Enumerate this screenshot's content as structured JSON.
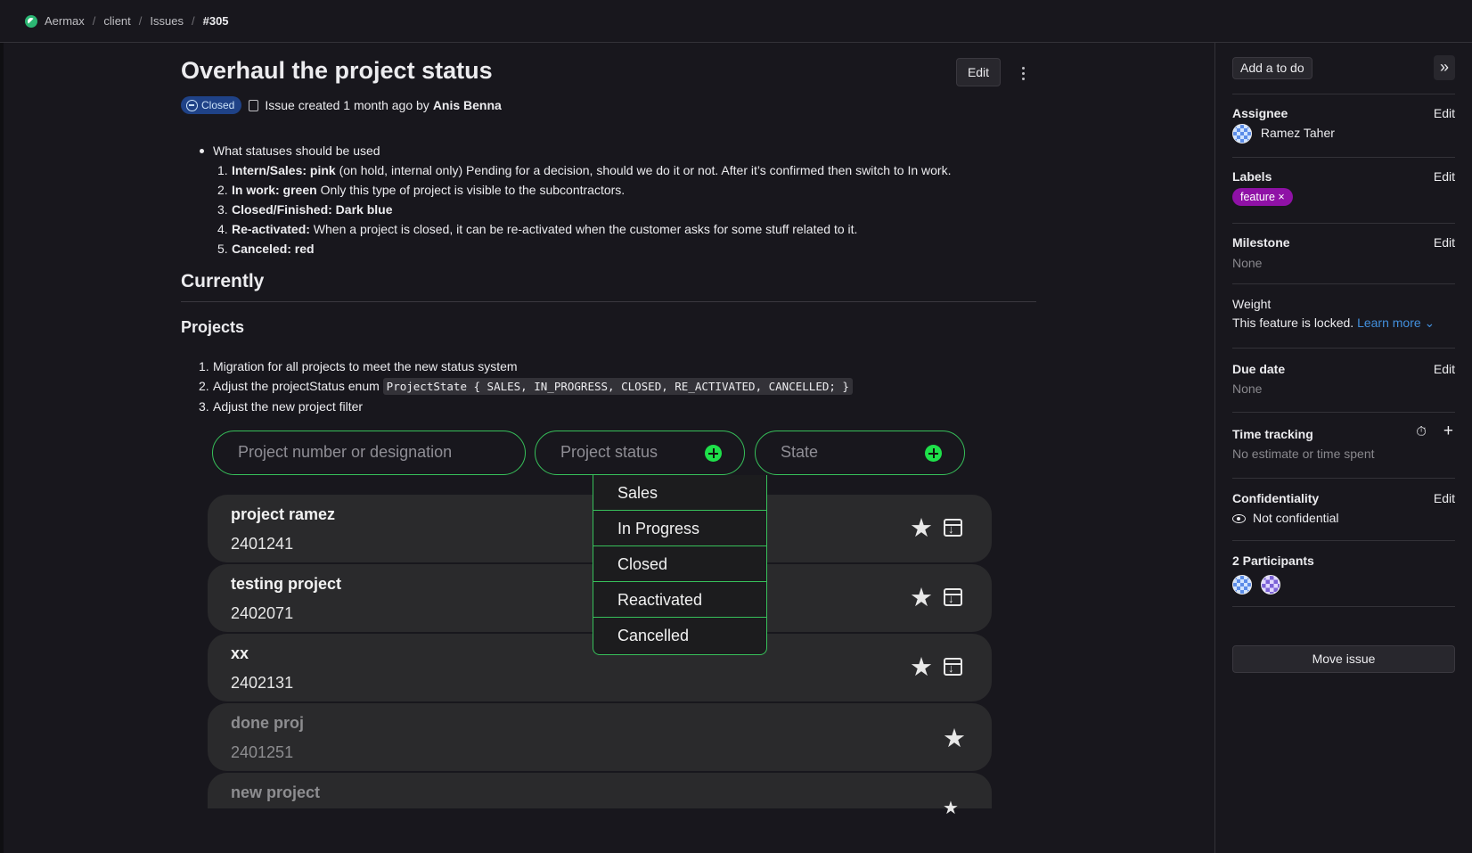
{
  "breadcrumb": [
    "Aermax",
    "client",
    "Issues",
    "#305"
  ],
  "issue": {
    "title": "Overhaul the project status",
    "edit_label": "Edit",
    "status": "Closed",
    "created_text": "Issue created 1 month ago by",
    "author": "Anis Benna"
  },
  "description": {
    "bullet": "What statuses should be used",
    "statuses": [
      {
        "n": "1.",
        "bold": "Intern/Sales: pink",
        "rest": " (on hold, internal only) Pending for a decision, should we do it or not. After it’s confirmed then switch to In work."
      },
      {
        "n": "2.",
        "bold": "In work: green",
        "rest": " Only this type of project is visible to the subcontractors."
      },
      {
        "n": "3.",
        "bold": "Closed/Finished: Dark blue",
        "rest": ""
      },
      {
        "n": "4.",
        "bold": "Re-activated:",
        "rest": " When a project is closed, it can be re-activated when the customer asks for some stuff related to it."
      },
      {
        "n": "5.",
        "bold": "Canceled: red",
        "rest": ""
      }
    ],
    "heading": "Currently",
    "subheading": "Projects",
    "tasks": [
      {
        "n": "1.",
        "text": "Migration for all projects to meet the new status system"
      },
      {
        "n": "2.",
        "text": "Adjust the projectStatus enum ",
        "code": "ProjectState { SALES, IN_PROGRESS, CLOSED, RE_ACTIVATED, CANCELLED; }"
      },
      {
        "n": "3.",
        "text": "Adjust the new project filter"
      }
    ]
  },
  "embed": {
    "search_placeholder": "Project number or designation",
    "status_placeholder": "Project status",
    "state_placeholder": "State",
    "dropdown": [
      "Sales",
      "In Progress",
      "Closed",
      "Reactivated",
      "Cancelled"
    ],
    "projects": [
      {
        "name": "project ramez",
        "number": "2401241"
      },
      {
        "name": "testing project",
        "number": "2402071"
      },
      {
        "name": "xx",
        "number": "2402131"
      },
      {
        "name": "done proj",
        "number": "2401251"
      },
      {
        "name": "new project",
        "number": ""
      }
    ],
    "star_glyph": "★"
  },
  "sidebar": {
    "todo_label": "Add a to do",
    "collapse_glyph": "»",
    "edit": "Edit",
    "assignee_title": "Assignee",
    "assignee": "Ramez Taher",
    "labels_title": "Labels",
    "label": "feature ×",
    "milestone_title": "Milestone",
    "milestone": "None",
    "weight_title": "Weight",
    "weight_text": "This feature is locked.",
    "learn_more": "Learn more ⌄",
    "due_title": "Due date",
    "due": "None",
    "time_title": "Time tracking",
    "time_text": "No estimate or time spent",
    "time_icon": "⏱",
    "plus": "+",
    "conf_title": "Confidentiality",
    "conf_text": "Not confidential",
    "participants_title": "2 Participants",
    "move_label": "Move issue"
  }
}
